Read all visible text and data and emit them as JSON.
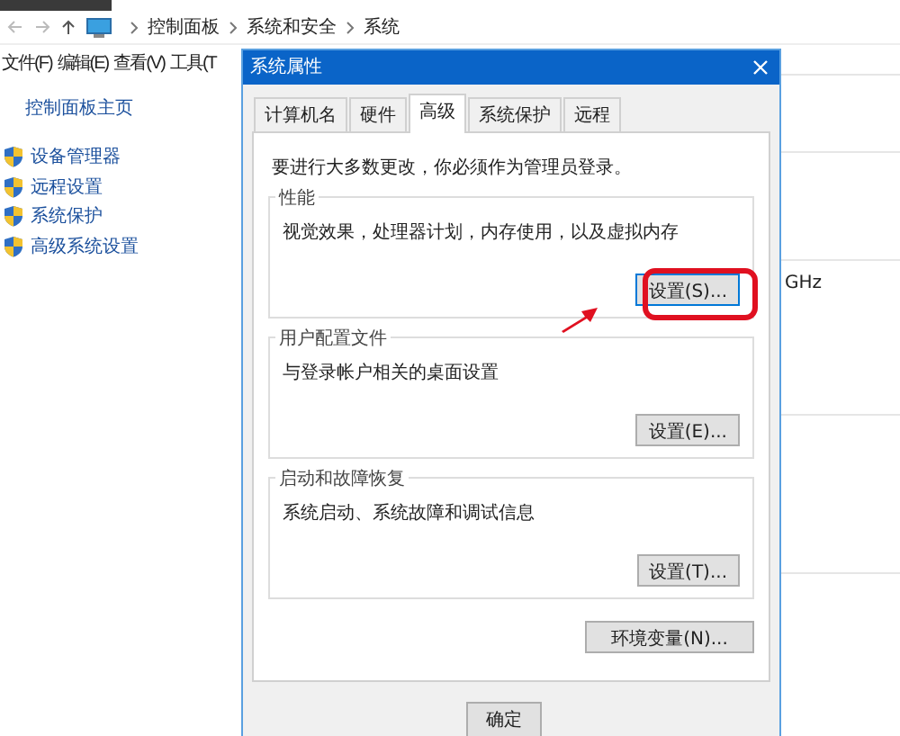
{
  "explorer": {
    "breadcrumb": [
      "控制面板",
      "系统和安全",
      "系统"
    ],
    "menu": [
      "文件(F)",
      "编辑(E)",
      "查看(V)",
      "工具(T"
    ],
    "sidebar": {
      "home": "控制面板主页",
      "links": [
        "设备管理器",
        "远程设置",
        "系统保护",
        "高级系统设置"
      ]
    },
    "background_text": "GHz"
  },
  "dialog": {
    "title": "系统属性",
    "tabs": [
      {
        "label": "计算机名",
        "selected": false
      },
      {
        "label": "硬件",
        "selected": false
      },
      {
        "label": "高级",
        "selected": true
      },
      {
        "label": "系统保护",
        "selected": false
      },
      {
        "label": "远程",
        "selected": false
      }
    ],
    "notice": "要进行大多数更改，你必须作为管理员登录。",
    "groups": [
      {
        "title": "性能",
        "description": "视觉效果，处理器计划，内存使用，以及虚拟内存",
        "button": "设置(S)...",
        "highlighted": true
      },
      {
        "title": "用户配置文件",
        "description": "与登录帐户相关的桌面设置",
        "button": "设置(E)...",
        "highlighted": false
      },
      {
        "title": "启动和故障恢复",
        "description": "系统启动、系统故障和调试信息",
        "button": "设置(T)...",
        "highlighted": false
      }
    ],
    "env_button": "环境变量(N)...",
    "footer_buttons": [
      "确定"
    ]
  }
}
